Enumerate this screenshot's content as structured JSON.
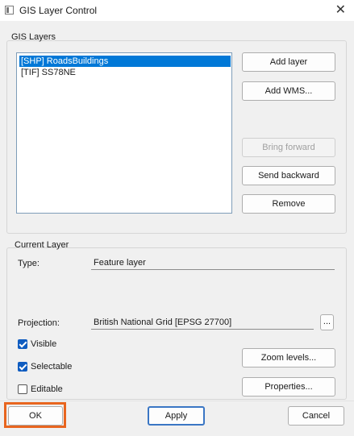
{
  "window": {
    "title": "GIS Layer Control",
    "close_glyph": "✕"
  },
  "layers_group": {
    "label": "GIS Layers",
    "items": [
      {
        "label": "[SHP] RoadsBuildings",
        "selected": true
      },
      {
        "label": "[TIF] SS78NE",
        "selected": false
      }
    ],
    "buttons": {
      "add_layer": "Add layer",
      "add_wms": "Add WMS...",
      "bring_forward": "Bring forward",
      "send_backward": "Send backward",
      "remove": "Remove"
    }
  },
  "current_layer": {
    "label": "Current Layer",
    "type_label": "Type:",
    "type_value": "Feature layer",
    "projection_label": "Projection:",
    "projection_value": "British National Grid [EPSG 27700]",
    "projection_browse": "...",
    "visible_label": "Visible",
    "visible_checked": true,
    "selectable_label": "Selectable",
    "selectable_checked": true,
    "editable_label": "Editable",
    "editable_checked": false,
    "zoom_levels": "Zoom levels...",
    "properties": "Properties..."
  },
  "footer": {
    "ok": "OK",
    "apply": "Apply",
    "cancel": "Cancel"
  },
  "colors": {
    "highlight": "#e8651f",
    "selection": "#0078d7",
    "checkbox": "#0f5cc0"
  }
}
